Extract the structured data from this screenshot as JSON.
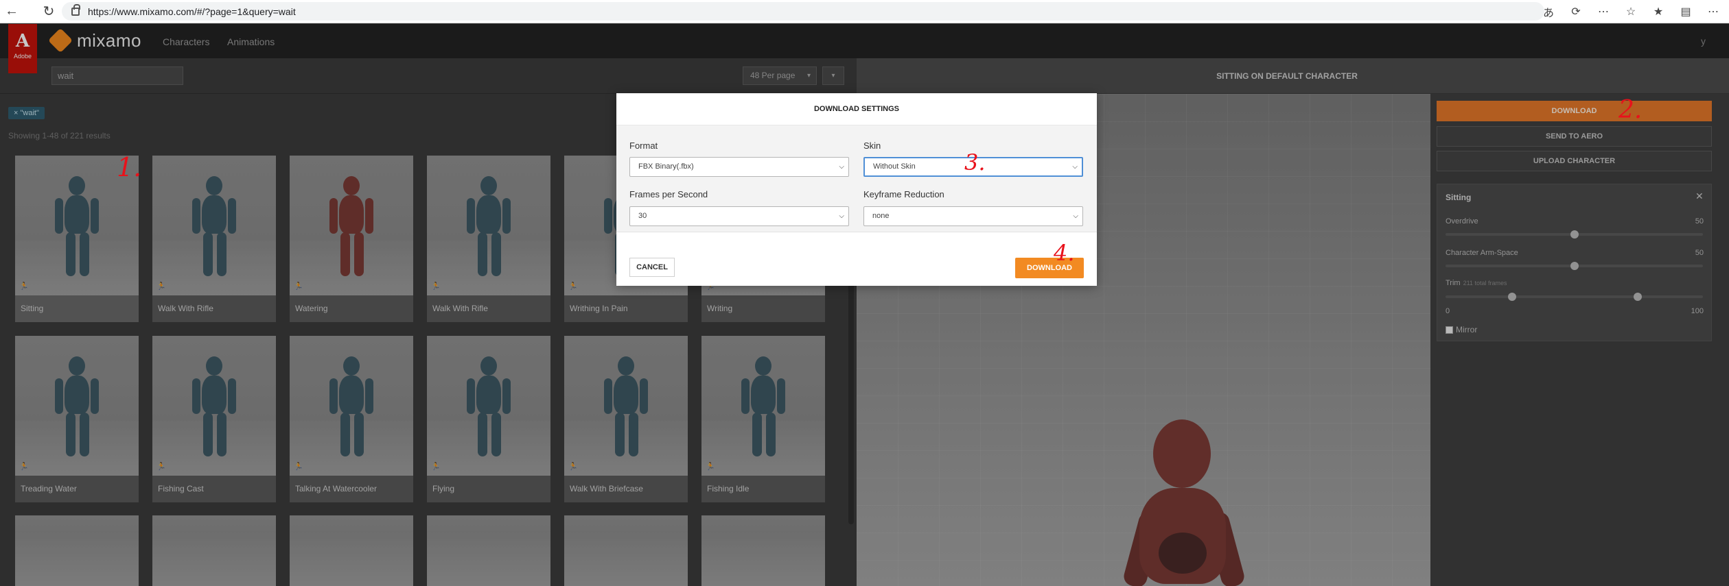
{
  "browser": {
    "url": "https://www.mixamo.com/#/?page=1&query=wait",
    "toolbar_icons": [
      "translate-icon",
      "sync-icon",
      "more-circle-icon",
      "star-icon",
      "collections-icon",
      "reading-list-icon",
      "menu-icon"
    ]
  },
  "header": {
    "adobe_text": "Adobe",
    "app_name": "mixamo",
    "nav": [
      "Characters",
      "Animations"
    ],
    "user_initial": "y"
  },
  "search": {
    "value": "wait",
    "per_page": "48 Per page"
  },
  "filter_tag": "× \"wait\"",
  "results_text": "Showing 1-48 of 221 results",
  "animations": [
    {
      "name": "Sitting",
      "color": "#3e5964"
    },
    {
      "name": "Walk With Rifle",
      "color": "#3e5964"
    },
    {
      "name": "Watering",
      "color": "#7a3a35"
    },
    {
      "name": "Walk With Rifle",
      "color": "#3e5964"
    },
    {
      "name": "Writhing In Pain",
      "color": "#3e5964"
    },
    {
      "name": "Writing",
      "color": "#3e5964"
    },
    {
      "name": "Treading Water",
      "color": "#3e5964"
    },
    {
      "name": "Fishing Cast",
      "color": "#3e5964"
    },
    {
      "name": "Talking At Watercooler",
      "color": "#3e5964"
    },
    {
      "name": "Flying",
      "color": "#3e5964"
    },
    {
      "name": "Walk With Briefcase",
      "color": "#3e5964"
    },
    {
      "name": "Fishing Idle",
      "color": "#3e5964"
    }
  ],
  "preview": {
    "title": "SITTING ON DEFAULT CHARACTER"
  },
  "side_panel": {
    "download_label": "DOWNLOAD",
    "send_label": "SEND TO AERO",
    "upload_label": "UPLOAD CHARACTER",
    "settings_title": "Sitting",
    "overdrive_label": "Overdrive",
    "overdrive_value": "50",
    "arm_space_label": "Character Arm-Space",
    "arm_space_value": "50",
    "trim_label": "Trim",
    "trim_sub": "211 total frames",
    "trim_min": "0",
    "trim_max": "100",
    "mirror_label": "Mirror"
  },
  "modal": {
    "title": "DOWNLOAD SETTINGS",
    "format_label": "Format",
    "format_value": "FBX Binary(.fbx)",
    "skin_label": "Skin",
    "skin_value": "Without Skin",
    "fps_label": "Frames per Second",
    "fps_value": "30",
    "keyframe_label": "Keyframe Reduction",
    "keyframe_value": "none",
    "cancel_label": "CANCEL",
    "download_label": "DOWNLOAD"
  },
  "annotations": {
    "step1": "1.",
    "step2": "2.",
    "step3": "3.",
    "step4": "4."
  },
  "colors": {
    "accent_orange": "#f28a22",
    "adobe_red": "#c4130b",
    "focus_blue": "#4f8fd6",
    "annotation_red": "#e8121b"
  }
}
